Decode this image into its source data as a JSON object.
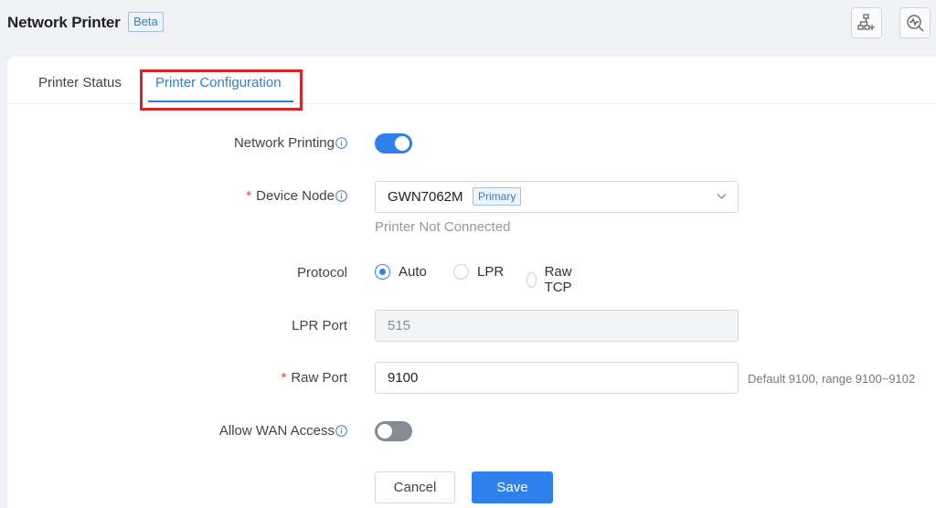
{
  "header": {
    "title": "Network Printer",
    "badge": "Beta",
    "icons": [
      "topology-add-icon",
      "diagnose-icon"
    ]
  },
  "tabs": [
    {
      "label": "Printer Status",
      "active": false
    },
    {
      "label": "Printer Configuration",
      "active": true
    }
  ],
  "form": {
    "network_printing": {
      "label": "Network Printing",
      "enabled": true
    },
    "device_node": {
      "label": "Device Node",
      "required": true,
      "value": "GWN7062M",
      "badge": "Primary",
      "helper": "Printer Not Connected"
    },
    "protocol": {
      "label": "Protocol",
      "options": [
        "Auto",
        "LPR",
        "Raw TCP"
      ],
      "selected": "Auto"
    },
    "lpr_port": {
      "label": "LPR Port",
      "value": "515",
      "disabled": true
    },
    "raw_port": {
      "label": "Raw Port",
      "required": true,
      "value": "9100",
      "hint": "Default 9100, range 9100~9102"
    },
    "allow_wan_access": {
      "label": "Allow WAN Access",
      "enabled": false
    }
  },
  "actions": {
    "cancel": "Cancel",
    "save": "Save"
  },
  "colors": {
    "accent": "#2f80ed",
    "highlight": "#d9252a",
    "toggle_off": "#858b93",
    "required": "#e0463a"
  }
}
